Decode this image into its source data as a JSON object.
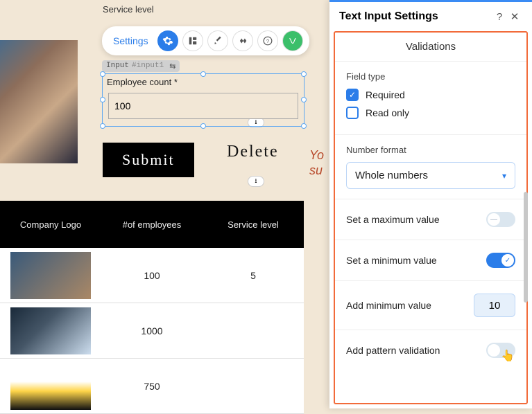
{
  "canvas": {
    "service_label": "Service level",
    "toolbar": {
      "settings": "Settings"
    },
    "input_tag": {
      "name": "Input",
      "id": "#input1"
    },
    "employee_count_label": "Employee count *",
    "employee_count_value": "100",
    "submit": "Submit",
    "delete": "Delete",
    "hint_line1": "Yo",
    "hint_line2": "su"
  },
  "table": {
    "headers": [
      "Company Logo",
      "#of employees",
      "Service level"
    ],
    "rows": [
      {
        "employees": "100",
        "service": "5"
      },
      {
        "employees": "1000",
        "service": ""
      },
      {
        "employees": "750",
        "service": ""
      }
    ]
  },
  "panel": {
    "title": "Text Input Settings",
    "section": "Validations",
    "field_type_label": "Field type",
    "required_label": "Required",
    "required_checked": true,
    "readonly_label": "Read only",
    "readonly_checked": false,
    "number_format_label": "Number format",
    "number_format_value": "Whole numbers",
    "max_label": "Set a maximum value",
    "max_on": false,
    "min_label": "Set a minimum value",
    "min_on": true,
    "add_min_label": "Add minimum value",
    "add_min_value": "10",
    "pattern_label": "Add pattern validation",
    "pattern_on": false
  }
}
